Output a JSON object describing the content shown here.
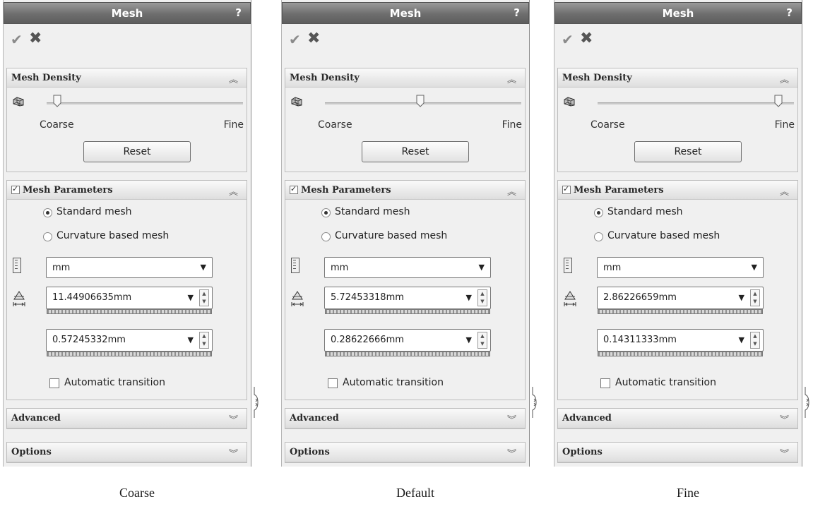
{
  "panels": [
    {
      "title": "Mesh",
      "help_icon": "?",
      "density": {
        "header": "Mesh Density",
        "coarse_label": "Coarse",
        "fine_label": "Fine",
        "slider_position": 0.0,
        "reset_label": "Reset"
      },
      "parameters": {
        "header": "Mesh Parameters",
        "checked": true,
        "standard_label": "Standard mesh",
        "curvature_label": "Curvature based mesh",
        "selected": "Standard mesh",
        "unit": "mm",
        "global_size": "11.44906635mm",
        "tolerance": "0.57245332mm",
        "auto_transition_label": "Automatic transition"
      },
      "advanced_header": "Advanced",
      "options_header": "Options",
      "caption": "Coarse"
    },
    {
      "title": "Mesh",
      "help_icon": "?",
      "density": {
        "header": "Mesh Density",
        "coarse_label": "Coarse",
        "fine_label": "Fine",
        "slider_position": 0.5,
        "reset_label": "Reset"
      },
      "parameters": {
        "header": "Mesh Parameters",
        "checked": true,
        "standard_label": "Standard mesh",
        "curvature_label": "Curvature based mesh",
        "selected": "Standard mesh",
        "unit": "mm",
        "global_size": "5.72453318mm",
        "tolerance": "0.28622666mm",
        "auto_transition_label": "Automatic transition"
      },
      "advanced_header": "Advanced",
      "options_header": "Options",
      "caption": "Default"
    },
    {
      "title": "Mesh",
      "help_icon": "?",
      "density": {
        "header": "Mesh Density",
        "coarse_label": "Coarse",
        "fine_label": "Fine",
        "slider_position": 1.0,
        "reset_label": "Reset"
      },
      "parameters": {
        "header": "Mesh Parameters",
        "checked": true,
        "standard_label": "Standard mesh",
        "curvature_label": "Curvature based mesh",
        "selected": "Standard mesh",
        "unit": "mm",
        "global_size": "2.86226659mm",
        "tolerance": "0.14311333mm",
        "auto_transition_label": "Automatic transition"
      },
      "advanced_header": "Advanced",
      "options_header": "Options",
      "caption": "Fine"
    }
  ]
}
